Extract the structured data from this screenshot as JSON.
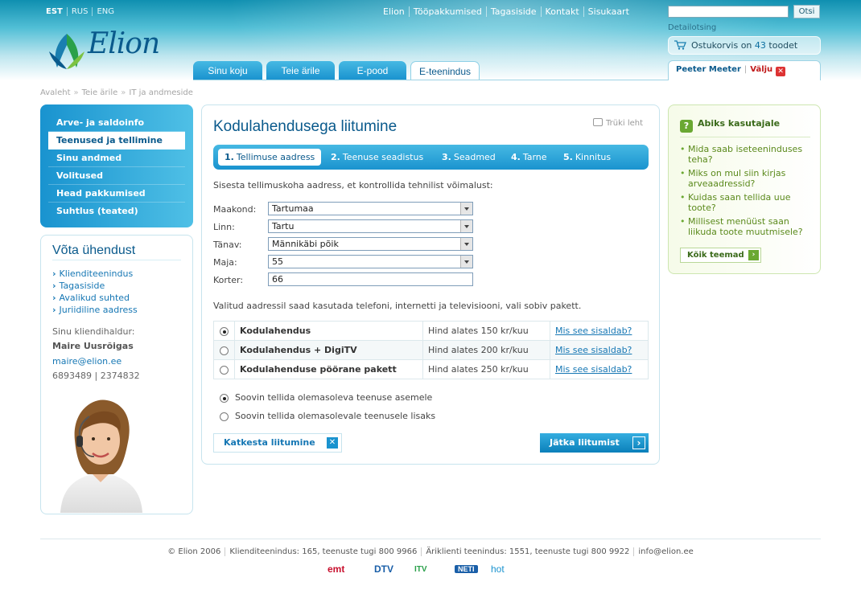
{
  "header": {
    "languages": [
      "EST",
      "RUS",
      "ENG"
    ],
    "top_links": [
      "Elion",
      "Tööpakkumised",
      "Tagasiside",
      "Kontakt",
      "Sisukaart"
    ],
    "search_button": "Otsi",
    "search_value": "",
    "detail_search": "Detailotsing",
    "cart_text": "Ostukorvis on",
    "cart_count": "43",
    "cart_unit": "toodet",
    "logo_text": "Elion",
    "tabs": [
      "Sinu koju",
      "Teie ärile",
      "E-pood",
      "E-teenindus"
    ],
    "user_name": "Peeter Meeter",
    "logout": "Välju"
  },
  "breadcrumb": [
    "Avaleht",
    "Teie ärile",
    "IT ja andmeside"
  ],
  "leftnav": {
    "items": [
      "Arve- ja saldoinfo",
      "Teenused ja tellimine",
      "Sinu andmed",
      "Volitused",
      "Head pakkumised",
      "Suhtlus (teated)"
    ],
    "active": "Teenused ja tellimine"
  },
  "contact": {
    "title": "Võta ühendust",
    "links": [
      "Klienditeenindus",
      "Tagasiside",
      "Avalikud suhted",
      "Juriidiline aadress"
    ],
    "manager_label": "Sinu kliendihaldur:",
    "manager_name": "Maire Uusrõigas",
    "manager_email": "maire@elion.ee",
    "manager_phone": "6893489 | 2374832"
  },
  "main": {
    "title": "Kodulahendusega liitumine",
    "print": "Trüki leht",
    "steps": [
      {
        "num": "1.",
        "label": "Tellimuse aadress"
      },
      {
        "num": "2.",
        "label": "Teenuse seadistus"
      },
      {
        "num": "3.",
        "label": "Seadmed"
      },
      {
        "num": "4.",
        "label": "Tarne"
      },
      {
        "num": "5.",
        "label": "Kinnitus"
      }
    ],
    "intro": "Sisesta tellimuskoha aadress, et kontrollida tehnilist võimalust:",
    "fields": {
      "county_label": "Maakond:",
      "county_value": "Tartumaa",
      "city_label": "Linn:",
      "city_value": "Tartu",
      "street_label": "Tänav:",
      "street_value": "Männikäbi põik",
      "house_label": "Maja:",
      "house_value": "55",
      "apt_label": "Korter:",
      "apt_value": "66"
    },
    "available_text": "Valitud aadressil saad kasutada telefoni, internetti ja televisiooni, vali sobiv pakett.",
    "packages": [
      {
        "name": "Kodulahendus",
        "price": "Hind alates 150 kr/kuu",
        "more": "Mis see sisaldab?",
        "selected": true
      },
      {
        "name": "Kodulahendus + DigiTV",
        "price": "Hind alates 200 kr/kuu",
        "more": "Mis see sisaldab?",
        "selected": false
      },
      {
        "name": "Kodulahenduse pöörane pakett",
        "price": "Hind alates 250 kr/kuu",
        "more": "Mis see sisaldab?",
        "selected": false
      }
    ],
    "options": [
      "Soovin tellida olemasoleva teenuse asemele",
      "Soovin tellida olemasolevale teenusele lisaks"
    ],
    "cancel_label": "Katkesta liitumine",
    "next_label": "Jätka liitumist"
  },
  "help": {
    "title": "Abiks kasutajale",
    "items": [
      "Mida saab iseteeninduses teha?",
      "Miks on mul siin kirjas arveaadressid?",
      "Kuidas saan tellida uue toote?",
      "Millisest menüüst saan liikuda toote muutmisele?"
    ],
    "all_topics": "Kõik teemad"
  },
  "footer": {
    "items": [
      "© Elion 2006",
      "Klienditeenindus: 165, teenuste tugi 800 9966",
      "Äriklienti teenindus: 1551, teenuste tugi 800 9922",
      "info@elion.ee"
    ],
    "brands": [
      "emt",
      "DTV",
      "ITV",
      "NETI",
      "hot"
    ]
  },
  "colors": {
    "brand_blue": "#0a5a8c",
    "accent_blue": "#1a93cf",
    "link_blue": "#1677b4",
    "help_green": "#5b8a1c"
  }
}
